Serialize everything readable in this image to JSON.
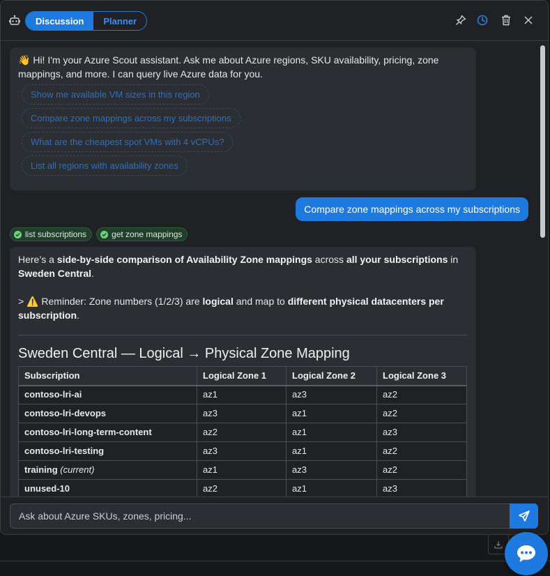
{
  "colors": {
    "accent": "#1f7ae0",
    "panel": "#1f2124",
    "bubble": "#2b2e32",
    "tool_bg": "#213f2b",
    "tool_check": "#6fd17e"
  },
  "header": {
    "modes": [
      "Discussion",
      "Planner"
    ],
    "active_mode": "Discussion",
    "icons": [
      "robot-icon",
      "pin-icon",
      "history-icon",
      "trash-icon",
      "close-icon"
    ]
  },
  "greeting": {
    "emoji": "👋",
    "text": "Hi! I'm your Azure Scout assistant. Ask me about Azure regions, SKU availability, pricing, zone mappings, and more. I can query live Azure data for you.",
    "suggestions": [
      "Show me available VM sizes in this region",
      "Compare zone mappings across my subscriptions",
      "What are the cheapest spot VMs with 4 vCPUs?",
      "List all regions with availability zones"
    ]
  },
  "user_message": "Compare zone mappings across my subscriptions",
  "tool_calls": [
    "list subscriptions",
    "get zone mappings"
  ],
  "answer": {
    "intro_1": "Here’s a ",
    "intro_b1": "side-by-side comparison of Availability Zone mappings",
    "intro_2": " across ",
    "intro_b2": "all your subscriptions",
    "intro_3": " in ",
    "intro_b3": "Sweden Central",
    "intro_4": ".",
    "reminder_prefix": "> ",
    "reminder_emoji": "⚠️",
    "reminder_1": " Reminder: Zone numbers (1/2/3) are ",
    "reminder_b1": "logical",
    "reminder_2": " and map to ",
    "reminder_b2": "different physical datacenters per subscription",
    "reminder_3": ".",
    "heading": "Sweden Central — Logical → Physical Zone Mapping",
    "table": {
      "headers": [
        "Subscription",
        "Logical Zone 1",
        "Logical Zone 2",
        "Logical Zone 3"
      ],
      "rows": [
        {
          "subscription": "contoso-lri-ai",
          "note": "",
          "z1": "az1",
          "z2": "az3",
          "z3": "az2"
        },
        {
          "subscription": "contoso-lri-devops",
          "note": "",
          "z1": "az3",
          "z2": "az1",
          "z3": "az2"
        },
        {
          "subscription": "contoso-lri-long-term-content",
          "note": "",
          "z1": "az2",
          "z2": "az1",
          "z3": "az3"
        },
        {
          "subscription": "contoso-lri-testing",
          "note": "",
          "z1": "az3",
          "z2": "az1",
          "z3": "az2"
        },
        {
          "subscription": "training",
          "note": "(current)",
          "z1": "az1",
          "z2": "az3",
          "z3": "az2"
        },
        {
          "subscription": "unused-10",
          "note": "",
          "z1": "az2",
          "z2": "az1",
          "z3": "az3"
        }
      ]
    }
  },
  "composer": {
    "placeholder": "Ask about Azure SKUs, zones, pricing..."
  }
}
